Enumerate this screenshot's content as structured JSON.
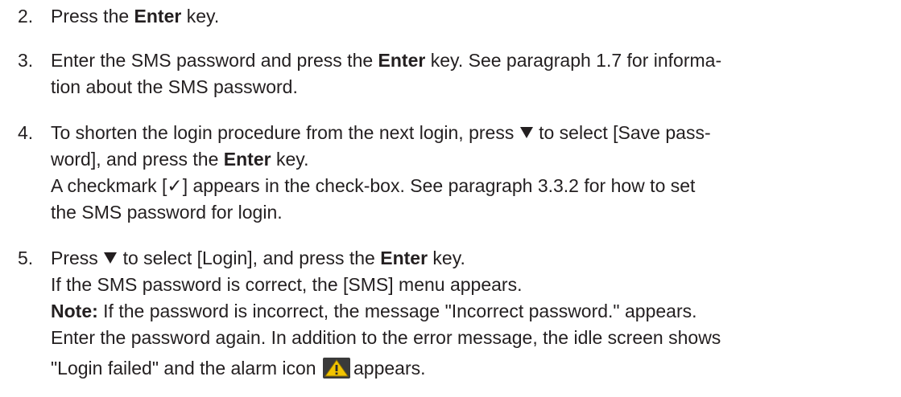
{
  "steps": [
    {
      "number": "2.",
      "lines": [
        {
          "pre": "Press the ",
          "bold": "Enter",
          "post": " key."
        }
      ]
    },
    {
      "number": "3.",
      "lines": [
        {
          "pre": "Enter the SMS password and press the ",
          "bold": "Enter",
          "post": " key. See paragraph 1.7 for informa-"
        },
        {
          "text": "tion about the SMS password."
        }
      ]
    },
    {
      "number": "4.",
      "lines": [
        {
          "pre": "To shorten the login procedure from the next login, press ",
          "post": " to select [Save pass-"
        },
        {
          "text": "word], and press the ",
          "bold": "Enter",
          "post": " key."
        },
        {
          "text": "A checkmark [✓] appears in the check-box. See paragraph 3.3.2 for how to set"
        },
        {
          "text": "the SMS password for login."
        }
      ]
    },
    {
      "number": "5.",
      "lines": [
        {
          "pre": "Press ",
          "post": " to select [Login], and press the ",
          "bold": "Enter",
          "end": " key."
        },
        {
          "text": "If the SMS password is correct, the [SMS] menu appears."
        },
        {
          "bold": "Note:",
          "post": " If the password is incorrect, the message \"Incorrect password.\" appears."
        },
        {
          "text": "Enter the password again. In addition to the error message, the idle screen shows"
        },
        {
          "pre": "\"Login failed\" and the alarm icon ",
          "post": "appears."
        }
      ]
    }
  ],
  "icons": {
    "down_triangle": "down-triangle-icon",
    "alarm": "alarm-icon"
  },
  "colors": {
    "text": "#231f20",
    "alarm_bg": "#3a3a3a",
    "alarm_triangle": "#f2c400"
  }
}
